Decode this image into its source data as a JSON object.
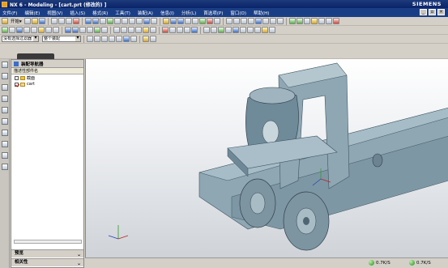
{
  "window": {
    "title": "NX 6 - Modeling - [cart.prt  (修改的) ]",
    "brand": "SIEMENS"
  },
  "menu": [
    "文件(F)",
    "编辑(E)",
    "视图(V)",
    "插入(S)",
    "格式(R)",
    "工具(T)",
    "装配(A)",
    "信息(I)",
    "分析(L)",
    "首选项(P)",
    "窗口(O)",
    "帮助(H)"
  ],
  "toolbar": {
    "start_label": "开始▾",
    "selection_filter": "没有选择过滤器",
    "assembly_scope": "整个装配"
  },
  "navigator": {
    "title": "装配导航器",
    "column_header": "描述性部件名",
    "items": [
      {
        "label": "截面",
        "checked": false
      },
      {
        "label": "cart",
        "checked": true
      }
    ],
    "panel1": "预览",
    "panel2": "相关性"
  },
  "status": {
    "item1": "0.7K/S",
    "item2": "0.7K/S"
  },
  "colors": {
    "part": "#8fa7b3",
    "part_dark": "#5b7482",
    "menubar": "#1a3e86"
  }
}
